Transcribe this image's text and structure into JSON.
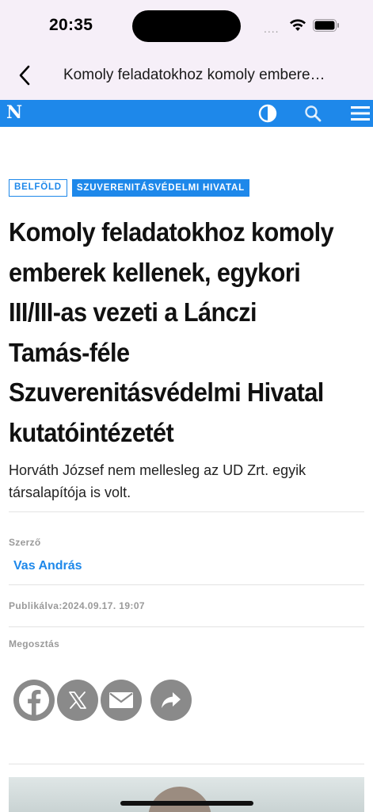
{
  "status_bar": {
    "time": "20:35",
    "icons": [
      "signal-icon",
      "wifi-icon",
      "battery-icon"
    ]
  },
  "nav": {
    "back_icon": "chevron-left-icon",
    "title": "Komoly feladatokhoz komoly embere…"
  },
  "site_header": {
    "logo": "N",
    "accent_color": "#1e88ea",
    "icons": [
      "contrast-icon",
      "search-icon",
      "menu-icon"
    ]
  },
  "article": {
    "tags": [
      "BELFÖLD",
      "SZUVERENITÁSVÉDELMI HIVATAL"
    ],
    "headline": "Komoly feladatokhoz komoly emberek kellenek, egykori III/III-as vezeti a Lánczi Tamás-féle Szuverenitásvédelmi Hivatal kutatóintézetét",
    "lead": "Horváth József nem mellesleg az UD Zrt. egyik társalapítója is volt.",
    "author_label": "Szerző",
    "author": "Vas András",
    "published": "Publikálva:2024.09.17. 19:07",
    "share_label": "Megosztás",
    "share_icons": [
      "facebook-icon",
      "x-icon",
      "mail-icon",
      "share-icon"
    ]
  }
}
